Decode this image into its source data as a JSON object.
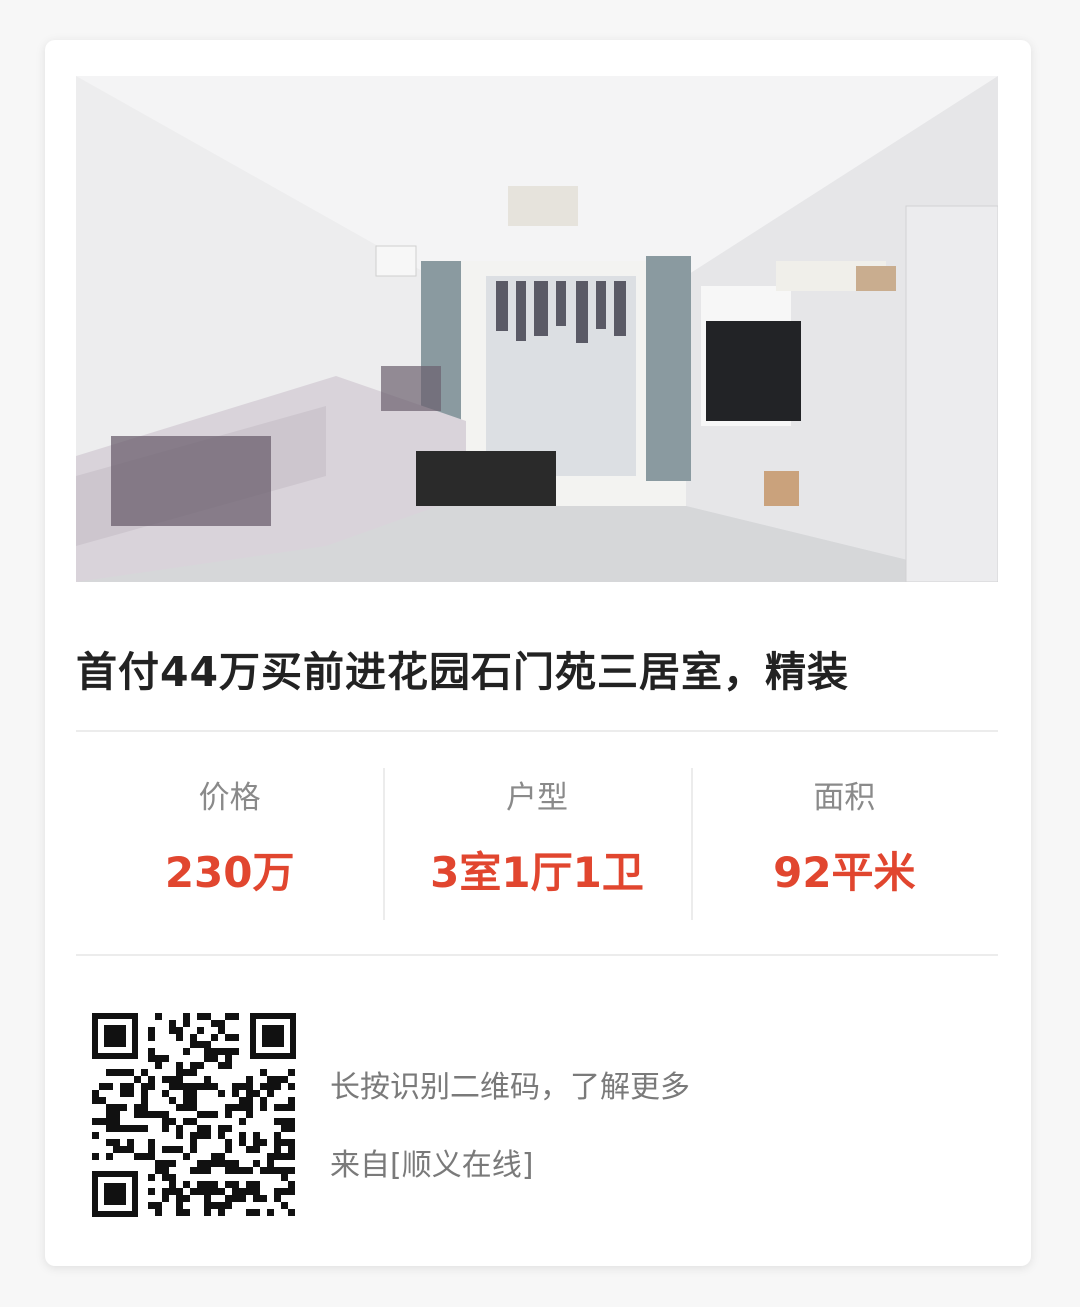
{
  "listing": {
    "title": "首付44万买前进花园石门苑三居室，精装",
    "stats": [
      {
        "label": "价格",
        "value": "230万"
      },
      {
        "label": "户型",
        "value": "3室1厅1卫"
      },
      {
        "label": "面积",
        "value": "92平米"
      }
    ]
  },
  "footer": {
    "qr_hint": "长按识别二维码，了解更多",
    "source": "来自[顺义在线]"
  },
  "colors": {
    "accent": "#e1462f",
    "label": "#8a8a8a",
    "title": "#222222"
  }
}
